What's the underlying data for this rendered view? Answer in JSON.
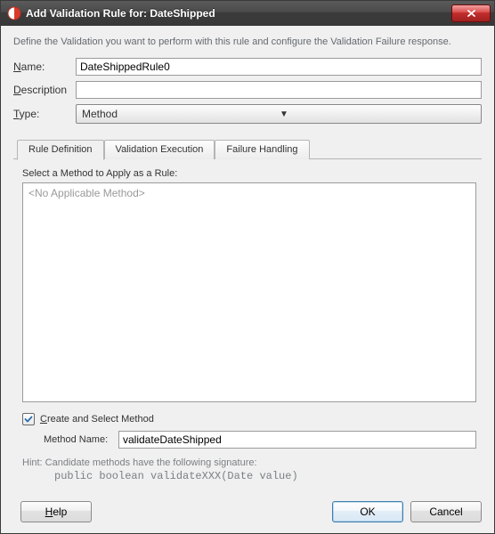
{
  "titlebar": {
    "title": "Add Validation Rule for: DateShipped"
  },
  "description": "Define the Validation you want to perform with this rule and configure the Validation Failure response.",
  "form": {
    "name_label_pre": "N",
    "name_label_post": "ame:",
    "name_value": "DateShippedRule0",
    "desc_label_pre": "D",
    "desc_label_post": "escription",
    "desc_value": "",
    "type_label_pre": "T",
    "type_label_post": "ype:",
    "type_value": "Method"
  },
  "tabs": {
    "t0": "Rule Definition",
    "t1": "Validation Execution",
    "t2": "Failure Handling"
  },
  "panel": {
    "select_method_label": "Select a Method to Apply as a Rule:",
    "list_placeholder": "<No Applicable Method>",
    "checkbox_label_pre": "C",
    "checkbox_label_post": "reate and Select Method",
    "checkbox_checked": true,
    "method_name_label": "Method Name:",
    "method_name_value": "validateDateShipped",
    "hint_line": "Hint: Candidate methods have the following signature:",
    "hint_code": "public boolean validateXXX(Date value)"
  },
  "buttons": {
    "help_pre": "H",
    "help_post": "elp",
    "ok": "OK",
    "cancel": "Cancel"
  }
}
